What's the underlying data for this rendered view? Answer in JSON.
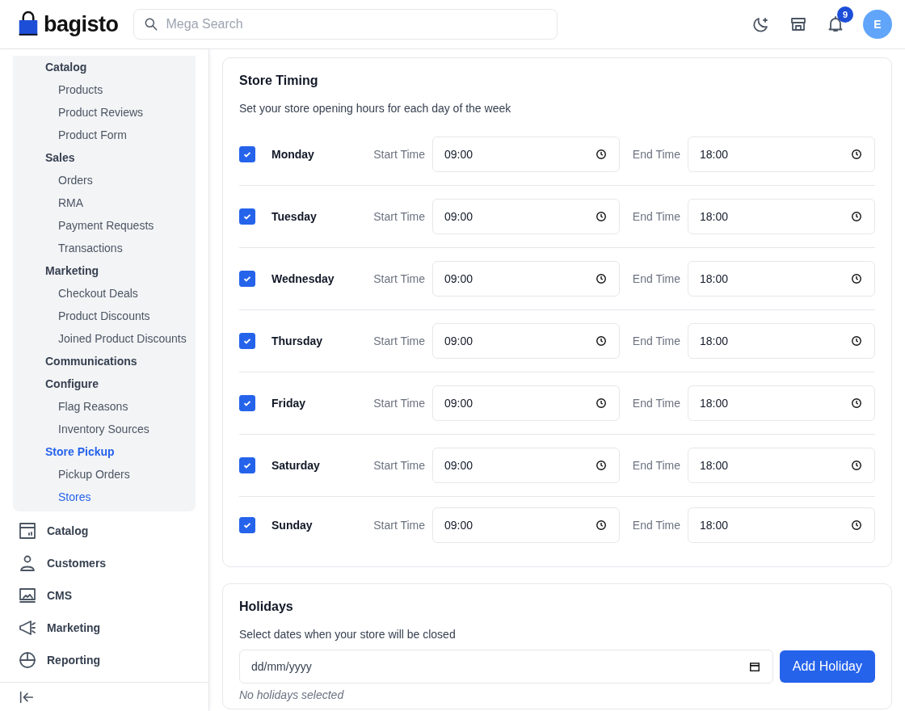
{
  "header": {
    "logo_text": "bagisto",
    "search": {
      "placeholder": "Mega Search"
    },
    "notification_count": "9",
    "avatar_initial": "E"
  },
  "sidebar": {
    "submenu": [
      {
        "label": "Catalog",
        "selected": false,
        "children": [
          {
            "label": "Products",
            "selected": false
          },
          {
            "label": "Product Reviews",
            "selected": false
          },
          {
            "label": "Product Form",
            "selected": false
          }
        ]
      },
      {
        "label": "Sales",
        "selected": false,
        "children": [
          {
            "label": "Orders",
            "selected": false
          },
          {
            "label": "RMA",
            "selected": false
          },
          {
            "label": "Payment Requests",
            "selected": false
          },
          {
            "label": "Transactions",
            "selected": false
          }
        ]
      },
      {
        "label": "Marketing",
        "selected": false,
        "children": [
          {
            "label": "Checkout Deals",
            "selected": false
          },
          {
            "label": "Product Discounts",
            "selected": false
          },
          {
            "label": "Joined Product Discounts",
            "selected": false
          }
        ]
      },
      {
        "label": "Communications",
        "selected": false
      },
      {
        "label": "Configure",
        "selected": false,
        "children": [
          {
            "label": "Flag Reasons",
            "selected": false
          },
          {
            "label": "Inventory Sources",
            "selected": false
          }
        ]
      },
      {
        "label": "Store Pickup",
        "selected": true,
        "children": [
          {
            "label": "Pickup Orders",
            "selected": false
          },
          {
            "label": "Stores",
            "selected": true
          }
        ]
      }
    ],
    "menu": [
      {
        "kind": "catalog",
        "label": "Catalog"
      },
      {
        "kind": "customers",
        "label": "Customers"
      },
      {
        "kind": "cms",
        "label": "CMS"
      },
      {
        "kind": "marketing",
        "label": "Marketing"
      },
      {
        "kind": "reporting",
        "label": "Reporting"
      }
    ]
  },
  "store_timing": {
    "title": "Store Timing",
    "subtitle": "Set your store opening hours for each day of the week",
    "days": [
      {
        "day": "Monday",
        "checked": true,
        "start_label": "Start Time",
        "start_value": "09:00",
        "end_label": "End Time",
        "end_value": "18:00"
      },
      {
        "day": "Tuesday",
        "checked": true,
        "start_label": "Start Time",
        "start_value": "09:00",
        "end_label": "End Time",
        "end_value": "18:00"
      },
      {
        "day": "Wednesday",
        "checked": true,
        "start_label": "Start Time",
        "start_value": "09:00",
        "end_label": "End Time",
        "end_value": "18:00"
      },
      {
        "day": "Thursday",
        "checked": true,
        "start_label": "Start Time",
        "start_value": "09:00",
        "end_label": "End Time",
        "end_value": "18:00"
      },
      {
        "day": "Friday",
        "checked": true,
        "start_label": "Start Time",
        "start_value": "09:00",
        "end_label": "End Time",
        "end_value": "18:00"
      },
      {
        "day": "Saturday",
        "checked": true,
        "start_label": "Start Time",
        "start_value": "09:00",
        "end_label": "End Time",
        "end_value": "18:00"
      },
      {
        "day": "Sunday",
        "checked": true,
        "start_label": "Start Time",
        "start_value": "09:00",
        "end_label": "End Time",
        "end_value": "18:00"
      }
    ]
  },
  "holidays": {
    "title": "Holidays",
    "subtitle": "Select dates when your store will be closed",
    "date_placeholder": "dd/mm/yyyy",
    "button": "Add Holiday",
    "empty_text": "No holidays selected"
  }
}
